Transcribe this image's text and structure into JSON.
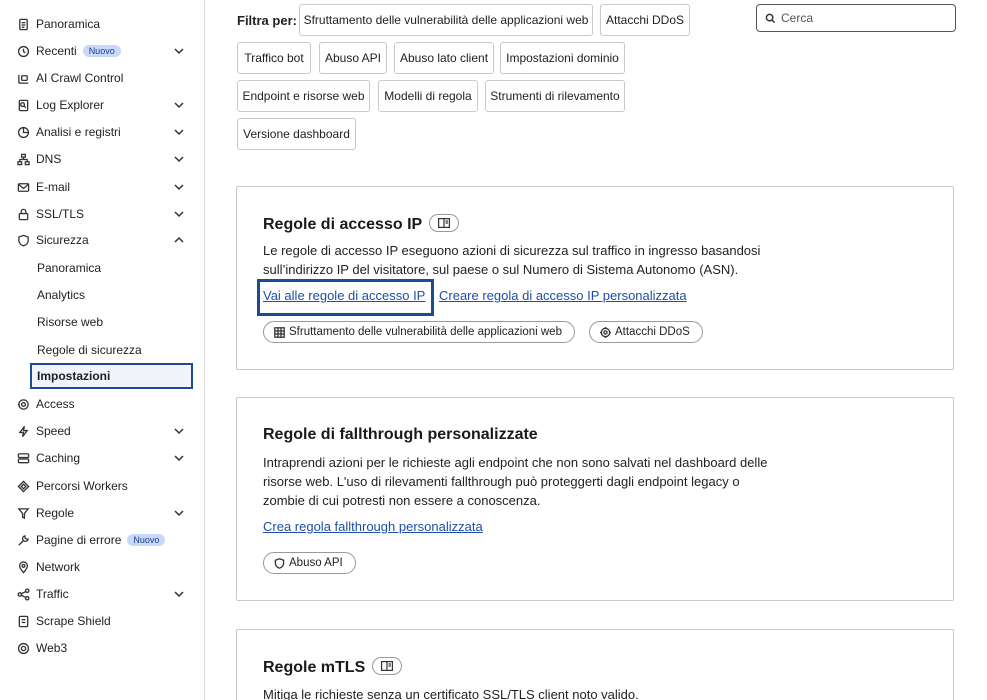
{
  "sidebar": {
    "items": [
      {
        "label": "Panoramica",
        "icon": "document-icon",
        "chevron": false
      },
      {
        "label": "Recenti",
        "icon": "history-icon",
        "chevron": true,
        "badge": "Nuovo"
      },
      {
        "label": "AI Crawl Control",
        "icon": "bot-icon",
        "chevron": false
      },
      {
        "label": "Log Explorer",
        "icon": "log-icon",
        "chevron": true
      },
      {
        "label": "Analisi e registri",
        "icon": "chart-icon",
        "chevron": true
      },
      {
        "label": "DNS",
        "icon": "network-tree-icon",
        "chevron": true
      },
      {
        "label": "E-mail",
        "icon": "email-icon",
        "chevron": true
      },
      {
        "label": "SSL/TLS",
        "icon": "lock-icon",
        "chevron": true
      },
      {
        "label": "Sicurezza",
        "icon": "shield-icon",
        "chevron": true,
        "expanded": true
      }
    ],
    "security_sub": [
      "Panoramica",
      "Analytics",
      "Risorse web",
      "Regole di sicurezza",
      "Impostazioni"
    ],
    "items_after": [
      {
        "label": "Access",
        "icon": "access-icon",
        "chevron": false
      },
      {
        "label": "Speed",
        "icon": "bolt-icon",
        "chevron": true
      },
      {
        "label": "Caching",
        "icon": "database-icon",
        "chevron": true
      },
      {
        "label": "Percorsi Workers",
        "icon": "workers-icon",
        "chevron": false
      },
      {
        "label": "Regole",
        "icon": "rules-icon",
        "chevron": true
      },
      {
        "label": "Pagine di errore",
        "icon": "wrench-icon",
        "chevron": false,
        "badge": "Nuovo"
      },
      {
        "label": "Network",
        "icon": "location-icon",
        "chevron": false
      },
      {
        "label": "Traffic",
        "icon": "traffic-icon",
        "chevron": true
      },
      {
        "label": "Scrape Shield",
        "icon": "scrape-icon",
        "chevron": false
      },
      {
        "label": "Web3",
        "icon": "web3-icon",
        "chevron": false
      }
    ]
  },
  "filters": {
    "label": "Filtra per:",
    "chips": [
      "Sfruttamento delle vulnerabilità delle applicazioni web",
      "Attacchi DDoS",
      "Traffico bot",
      "Abuso API",
      "Abuso lato client",
      "Impostazioni dominio",
      "Endpoint e risorse web",
      "Modelli di regola",
      "Strumenti di rilevamento",
      "Versione dashboard"
    ]
  },
  "search": {
    "placeholder": "Cerca"
  },
  "cards": [
    {
      "title": "Regole di accesso IP",
      "description": "Le regole di accesso IP eseguono azioni di sicurezza sul traffico in ingresso basandosi sull’indirizzo IP del visitatore, sul paese o sul Numero di Sistema Autonomo (ASN).",
      "links": [
        "Vai alle regole di accesso IP",
        "Creare regola di accesso IP personalizzata"
      ],
      "tags": [
        "Sfruttamento delle vulnerabilità delle applicazioni web",
        "Attacchi DDoS"
      ]
    },
    {
      "title": "Regole di fallthrough personalizzate",
      "description": "Intraprendi azioni per le richieste agli endpoint che non sono salvati nel dashboard delle risorse web. L'uso di rilevamenti fallthrough può proteggerti dagli endpoint legacy o zombie di cui potresti non essere a conoscenza.",
      "links": [
        "Crea regola fallthrough personalizzata"
      ],
      "tags": [
        "Abuso API"
      ]
    },
    {
      "title": "Regole mTLS",
      "description": "Mitiga le richieste senza un certificato SSL/TLS client noto valido."
    }
  ]
}
